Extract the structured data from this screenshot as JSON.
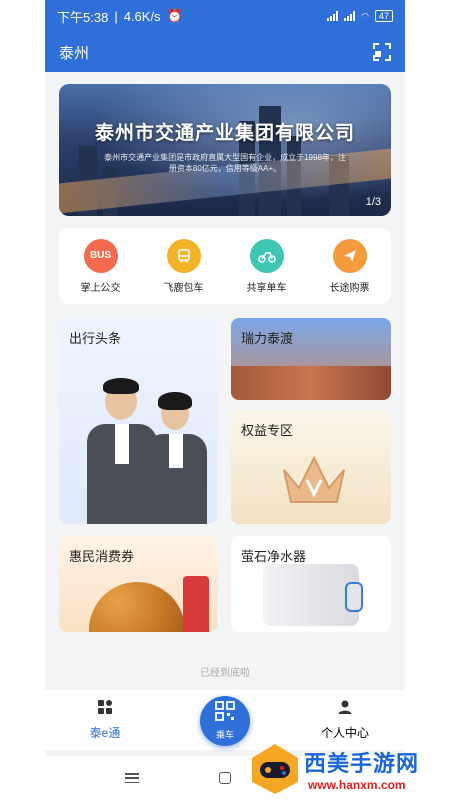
{
  "status": {
    "time": "下午5:38",
    "speed": "4.6K/s",
    "battery": "47"
  },
  "header": {
    "city": "泰州"
  },
  "banner": {
    "title": "泰州市交通产业集团有限公司",
    "desc": "泰州市交通产业集团是市政府直属大型国有企业，成立于1998年，注册资本80亿元，信用等级AA+。",
    "pager": "1/3"
  },
  "shortcuts": [
    {
      "label": "掌上公交",
      "icon": "BUS",
      "color": "#f26a4f"
    },
    {
      "label": "飞鹿包车",
      "icon": "bus-icon",
      "color": "#f5b32a"
    },
    {
      "label": "共享单车",
      "icon": "bike-icon",
      "color": "#3ec6b3"
    },
    {
      "label": "长途购票",
      "icon": "plane-icon",
      "color": "#f59a3d"
    }
  ],
  "cards": {
    "news": "出行头条",
    "ferry": "瑞力泰渡",
    "benefits": "权益专区",
    "coupons": "惠民消费券",
    "water": "萤石净水器"
  },
  "footer_note": "已经到底啦",
  "tabs": {
    "home": "泰e通",
    "ride": "乘车",
    "profile": "个人中心"
  },
  "watermark": {
    "title": "西美手游网",
    "url": "www.hanxm.com"
  },
  "colors": {
    "accent": "#2f6fd9"
  }
}
